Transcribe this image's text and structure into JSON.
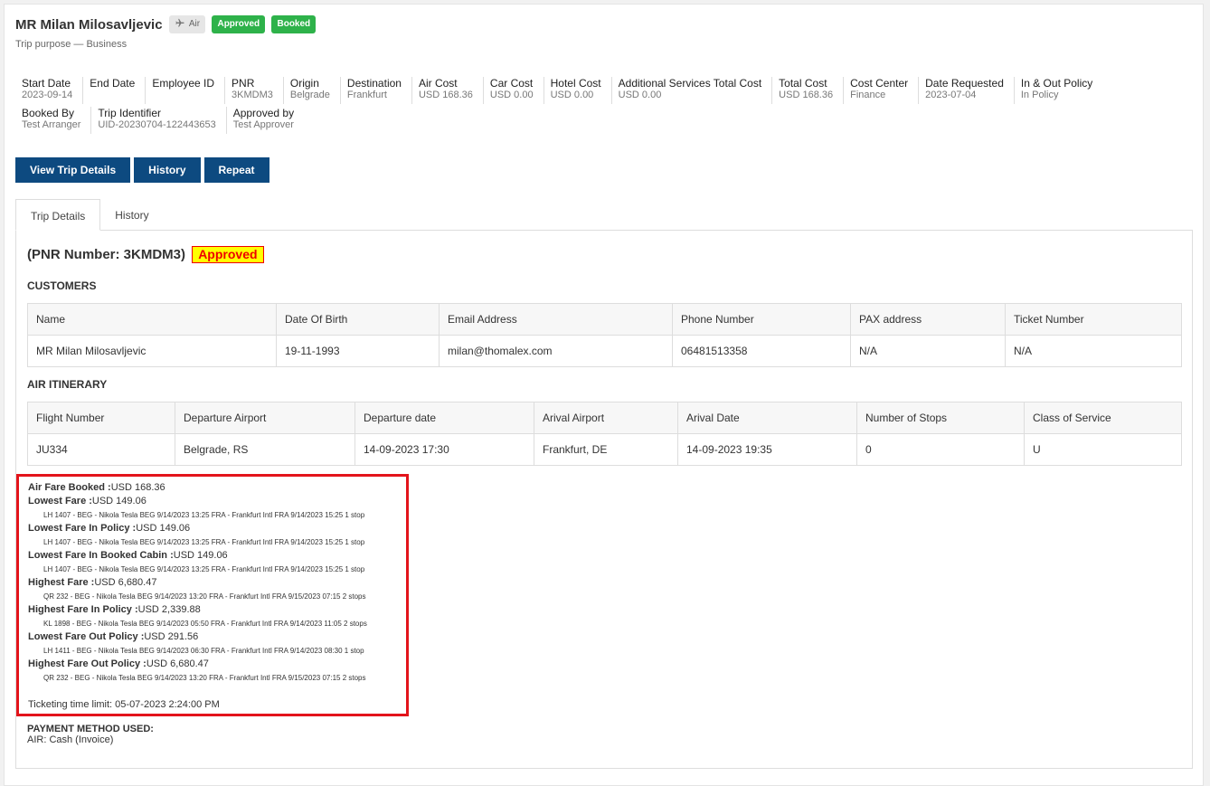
{
  "header": {
    "name": "MR Milan Milosavljevic",
    "tags": {
      "air": "Air",
      "approved": "Approved",
      "booked": "Booked"
    },
    "purpose": "Trip purpose — Business",
    "air_icon": "airplane-icon"
  },
  "summary_row1": [
    {
      "k": "Start Date",
      "v": "2023-09-14"
    },
    {
      "k": "End Date",
      "v": ""
    },
    {
      "k": "Employee ID",
      "v": ""
    },
    {
      "k": "PNR",
      "v": "3KMDM3"
    },
    {
      "k": "Origin",
      "v": "Belgrade"
    },
    {
      "k": "Destination",
      "v": "Frankfurt"
    },
    {
      "k": "Air Cost",
      "v": "USD 168.36"
    },
    {
      "k": "Car Cost",
      "v": "USD 0.00"
    },
    {
      "k": "Hotel Cost",
      "v": "USD 0.00"
    },
    {
      "k": "Additional Services Total Cost",
      "v": "USD 0.00"
    },
    {
      "k": "Total Cost",
      "v": "USD 168.36"
    },
    {
      "k": "Cost Center",
      "v": "Finance"
    },
    {
      "k": "Date Requested",
      "v": "2023-07-04"
    },
    {
      "k": "In & Out Policy",
      "v": "In Policy"
    }
  ],
  "summary_row2": [
    {
      "k": "Booked By",
      "v": "Test Arranger"
    },
    {
      "k": "Trip Identifier",
      "v": "UID-20230704-122443653"
    },
    {
      "k": "Approved by",
      "v": "Test Approver"
    }
  ],
  "buttons": {
    "view": "View Trip Details",
    "history": "History",
    "repeat": "Repeat"
  },
  "tabs": {
    "trip": "Trip Details",
    "history": "History"
  },
  "pnr": {
    "label": "(PNR Number: 3KMDM3)",
    "status": "Approved"
  },
  "customers": {
    "title": "CUSTOMERS",
    "headers": [
      "Name",
      "Date Of Birth",
      "Email Address",
      "Phone Number",
      "PAX address",
      "Ticket Number"
    ],
    "row": [
      "MR Milan Milosavljevic",
      "19-11-1993",
      "milan@thomalex.com",
      "06481513358",
      "N/A",
      "N/A"
    ]
  },
  "air": {
    "title": "AIR ITINERARY",
    "headers": [
      "Flight Number",
      "Departure Airport",
      "Departure date",
      "Arival Airport",
      "Arival Date",
      "Number of Stops",
      "Class of Service"
    ],
    "row": [
      "JU334",
      "Belgrade, RS",
      "14-09-2023 17:30",
      "Frankfurt, DE",
      "14-09-2023 19:35",
      "0",
      "U"
    ]
  },
  "fares": {
    "booked_label": "Air Fare Booked :",
    "booked_value": "USD 168.36",
    "items": [
      {
        "label": "Lowest Fare :",
        "value": "USD 149.06",
        "detail": "LH 1407 - BEG - Nikola Tesla BEG 9/14/2023 13:25 FRA - Frankfurt Intl FRA 9/14/2023 15:25 1 stop"
      },
      {
        "label": "Lowest Fare In Policy :",
        "value": "USD 149.06",
        "detail": "LH 1407 - BEG - Nikola Tesla BEG 9/14/2023 13:25 FRA - Frankfurt Intl FRA 9/14/2023 15:25 1 stop"
      },
      {
        "label": "Lowest Fare In Booked Cabin :",
        "value": "USD 149.06",
        "detail": "LH 1407 - BEG - Nikola Tesla BEG 9/14/2023 13:25 FRA - Frankfurt Intl FRA 9/14/2023 15:25 1 stop"
      },
      {
        "label": "Highest Fare :",
        "value": "USD 6,680.47",
        "detail": "QR 232 - BEG - Nikola Tesla BEG 9/14/2023 13:20 FRA - Frankfurt Intl FRA 9/15/2023 07:15 2 stops"
      },
      {
        "label": "Highest Fare In Policy :",
        "value": "USD 2,339.88",
        "detail": "KL 1898 - BEG - Nikola Tesla BEG 9/14/2023 05:50 FRA - Frankfurt Intl FRA 9/14/2023 11:05 2 stops"
      },
      {
        "label": "Lowest Fare Out Policy :",
        "value": "USD 291.56",
        "detail": "LH 1411 - BEG - Nikola Tesla BEG 9/14/2023 06:30 FRA - Frankfurt Intl FRA 9/14/2023 08:30 1 stop"
      },
      {
        "label": "Highest Fare Out Policy :",
        "value": "USD 6,680.47",
        "detail": "QR 232 - BEG - Nikola Tesla BEG 9/14/2023 13:20 FRA - Frankfurt Intl FRA 9/15/2023 07:15 2 stops"
      }
    ],
    "ticketing": "Ticketing time limit: 05-07-2023 2:24:00 PM"
  },
  "payment": {
    "title": "PAYMENT METHOD USED:",
    "value": "AIR: Cash (Invoice)"
  }
}
